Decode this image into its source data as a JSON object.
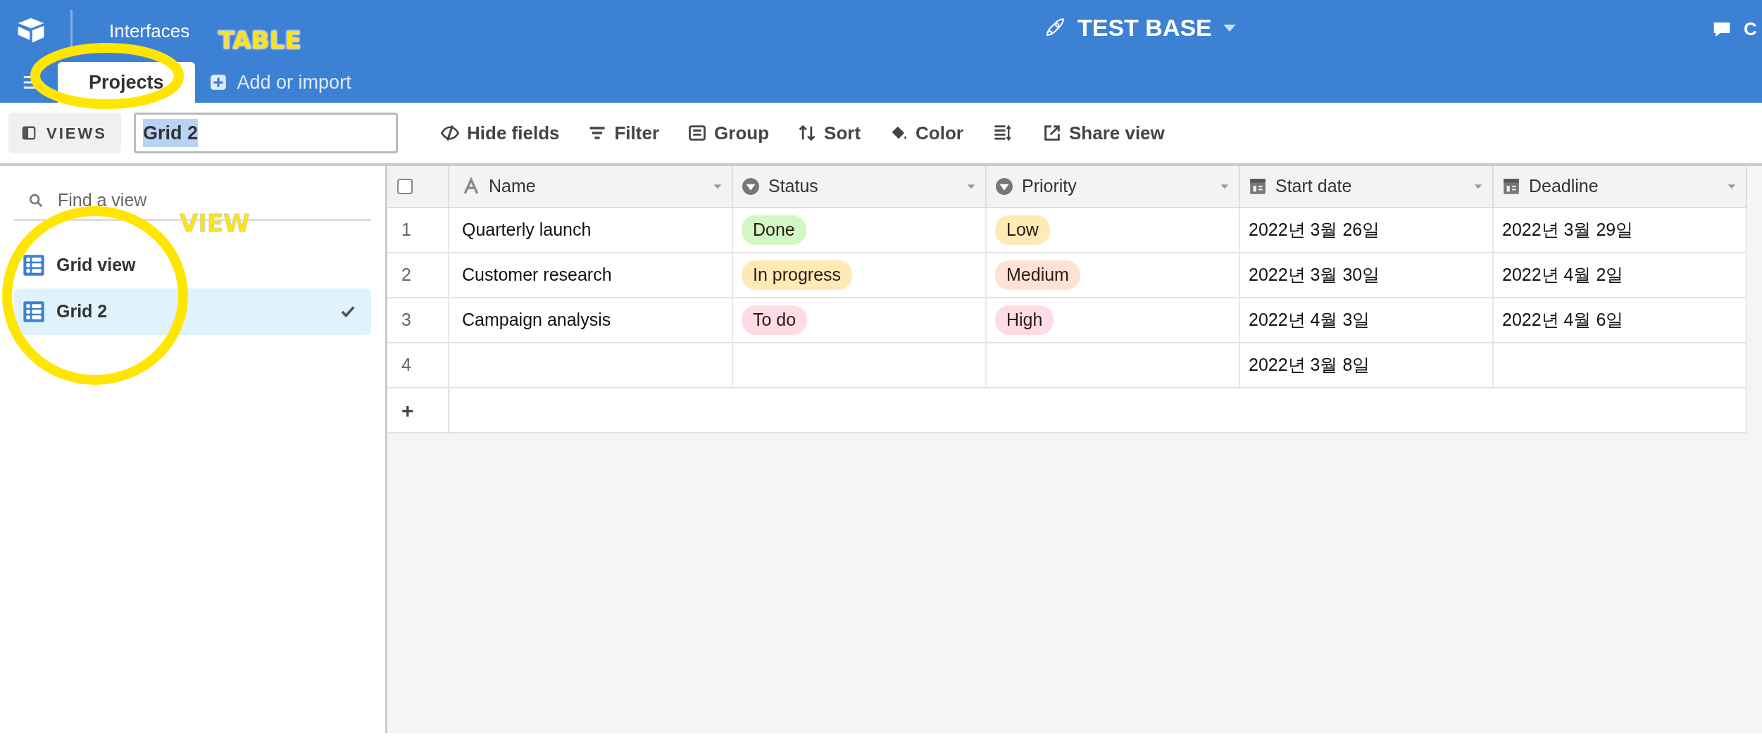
{
  "app": {
    "menu": "Interfaces",
    "base_title": "TEST BASE",
    "top_right": "C"
  },
  "tables": [
    {
      "label": "Projects",
      "selected": true
    }
  ],
  "add_table": "Add or import",
  "toolbar": {
    "views_button": "VIEWS",
    "view_name": "Grid 2",
    "actions": [
      {
        "kind": "hide",
        "label": "Hide fields"
      },
      {
        "kind": "filter",
        "label": "Filter"
      },
      {
        "kind": "group",
        "label": "Group"
      },
      {
        "kind": "sort",
        "label": "Sort"
      },
      {
        "kind": "color",
        "label": "Color"
      },
      {
        "kind": "rowheight"
      },
      {
        "kind": "share",
        "label": "Share view"
      }
    ]
  },
  "sidebar": {
    "search_placeholder": "Find a view",
    "views": [
      {
        "name": "Grid view",
        "selected": false
      },
      {
        "name": "Grid 2",
        "selected": true
      }
    ]
  },
  "table": {
    "select_all": {
      "checked": false
    },
    "columns": [
      {
        "kind": "text",
        "label": "Name"
      },
      {
        "kind": "select",
        "label": "Status"
      },
      {
        "kind": "select",
        "label": "Priority"
      },
      {
        "kind": "date",
        "label": "Start date"
      },
      {
        "kind": "date",
        "label": "Deadline"
      }
    ],
    "rows": [
      {
        "number": "1",
        "cells": [
          "Quarterly launch",
          {
            "text": "Done",
            "color": "#d1f7c4"
          },
          {
            "text": "Low",
            "color": "#ffeab6"
          },
          "2022년 3월 26일",
          "2022년 3월 29일"
        ]
      },
      {
        "number": "2",
        "cells": [
          "Customer research",
          {
            "text": "In progress",
            "color": "#ffeab6"
          },
          {
            "text": "Medium",
            "color": "#fee2d5"
          },
          "2022년 3월 30일",
          "2022년 4월 2일"
        ]
      },
      {
        "number": "3",
        "cells": [
          "Campaign analysis",
          {
            "text": "To do",
            "color": "#ffdce5"
          },
          {
            "text": "High",
            "color": "#ffdce5"
          },
          "2022년 4월 3일",
          "2022년 4월 6일"
        ]
      },
      {
        "number": "4",
        "cells": [
          null,
          null,
          null,
          "2022년 3월 8일",
          null
        ]
      }
    ],
    "add_row": "+"
  },
  "annotations": [
    {
      "kind": "circle"
    },
    {
      "kind": "label",
      "text": "TABLE"
    },
    {
      "kind": "circle"
    },
    {
      "kind": "label",
      "text": "VIEW"
    }
  ]
}
